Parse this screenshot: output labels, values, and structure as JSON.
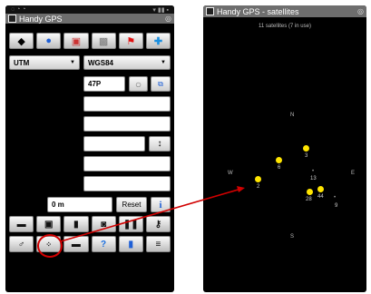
{
  "left_screen": {
    "app_title": "Handy GPS",
    "toolbar_icons": [
      "location-icon",
      "globe-icon",
      "target-icon",
      "map-icon",
      "flag-icon",
      "plus-icon"
    ],
    "coord_system": "UTM",
    "datum": "WGS84",
    "zone": "47P",
    "distance_value": "0 m",
    "reset_label": "Reset",
    "info_label": "i",
    "bottom_row1_icons": [
      "folder-icon",
      "save-icon",
      "trash-icon",
      "camera-icon",
      "pause-icon",
      "key-icon"
    ],
    "bottom_row2_icons": [
      "settings-icon",
      "satellites-icon",
      "line-icon",
      "help-icon",
      "export-icon",
      "menu-icon"
    ],
    "help_label": "?"
  },
  "right_screen": {
    "app_title": "Handy GPS - satellites",
    "subtitle": "11 satellites (7 in use)",
    "directions": {
      "north": "N",
      "west": "W",
      "east": "E",
      "south": "S"
    },
    "satellite_ids": [
      "2",
      "6",
      "3",
      "28",
      "44",
      "9",
      "13"
    ]
  },
  "colors": {
    "highlight_circle": "#d10000",
    "satellite_in_use": "#ffe500"
  }
}
